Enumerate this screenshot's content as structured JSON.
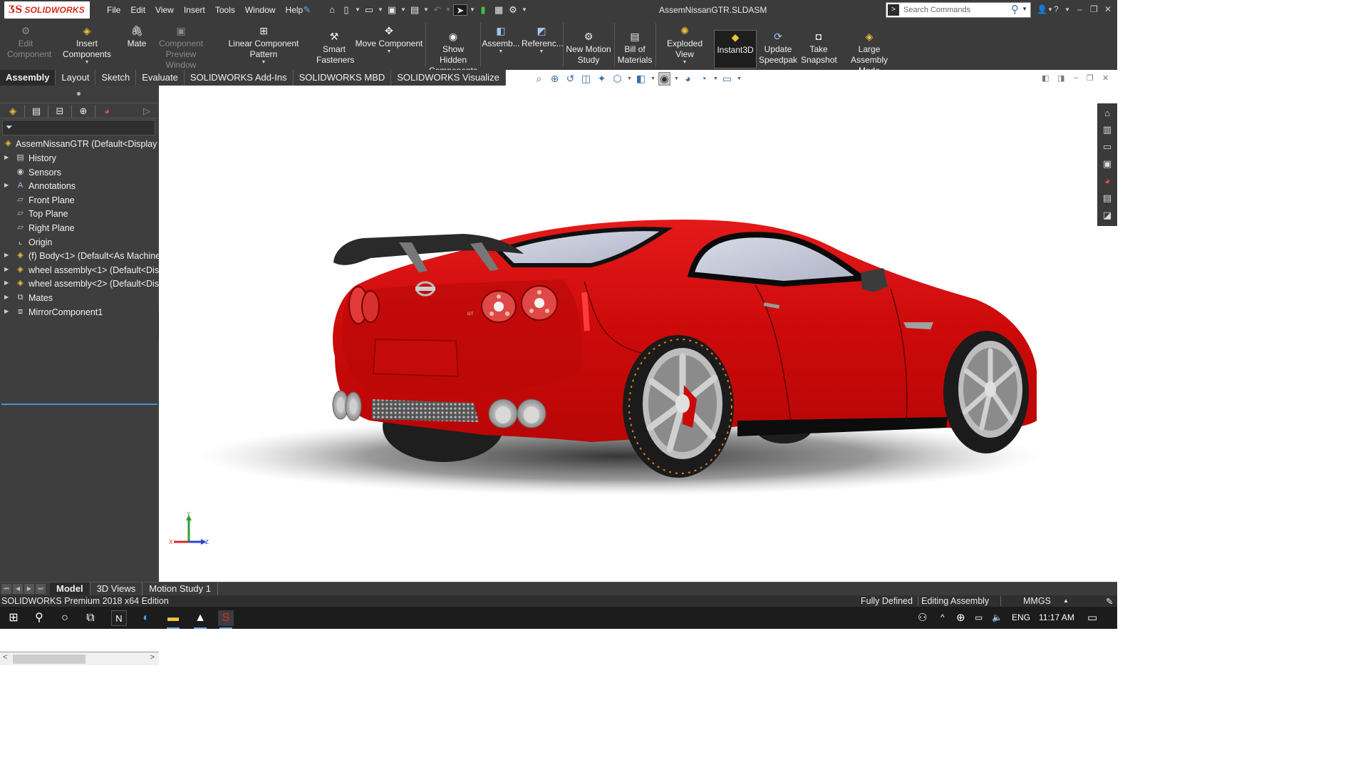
{
  "app": {
    "brand": "SOLIDWORKS",
    "document_title": "AssemNissanGTR.SLDASM",
    "accent_color": "#d52b1e"
  },
  "menu": [
    "File",
    "Edit",
    "View",
    "Insert",
    "Tools",
    "Window",
    "Help"
  ],
  "search": {
    "placeholder": "Search Commands"
  },
  "commands": {
    "edit_component": "Edit Component",
    "insert_components": "Insert Components",
    "mate": "Mate",
    "component_preview": "Component Preview Window",
    "linear_pattern": "Linear Component Pattern",
    "smart_fasteners": "Smart Fasteners",
    "move_component": "Move Component",
    "show_hidden": "Show Hidden Components",
    "assembly_features": "Assemb...",
    "reference_geometry": "Referenc...",
    "new_motion_study": "New Motion Study",
    "bill_of_materials": "Bill of Materials",
    "exploded_view": "Exploded View",
    "instant3d": "Instant3D",
    "update_speedpak": "Update Speedpak",
    "take_snapshot": "Take Snapshot",
    "large_assembly_mode": "Large Assembly Mode"
  },
  "tabs": [
    "Assembly",
    "Layout",
    "Sketch",
    "Evaluate",
    "SOLIDWORKS Add-Ins",
    "SOLIDWORKS MBD",
    "SOLIDWORKS Visualize"
  ],
  "tree": {
    "root": "AssemNissanGTR  (Default<Display S",
    "items": [
      {
        "label": "History",
        "icon": "history-icon",
        "expandable": true
      },
      {
        "label": "Sensors",
        "icon": "sensors-icon",
        "expandable": false
      },
      {
        "label": "Annotations",
        "icon": "annotations-icon",
        "expandable": true
      },
      {
        "label": "Front Plane",
        "icon": "plane-icon",
        "expandable": false
      },
      {
        "label": "Top Plane",
        "icon": "plane-icon",
        "expandable": false
      },
      {
        "label": "Right Plane",
        "icon": "plane-icon",
        "expandable": false
      },
      {
        "label": "Origin",
        "icon": "origin-icon",
        "expandable": false
      },
      {
        "label": "(f) Body<1> (Default<As Machine",
        "icon": "part-icon",
        "expandable": true
      },
      {
        "label": "wheel assembly<1> (Default<Dis",
        "icon": "subassembly-icon",
        "expandable": true
      },
      {
        "label": "wheel assembly<2> (Default<Dis",
        "icon": "subassembly-icon",
        "expandable": true
      },
      {
        "label": "Mates",
        "icon": "mates-icon",
        "expandable": true
      },
      {
        "label": "MirrorComponent1",
        "icon": "mirror-component-icon",
        "expandable": true
      }
    ]
  },
  "bottom_tabs": [
    "Model",
    "3D Views",
    "Motion Study 1"
  ],
  "status": {
    "edition": "SOLIDWORKS Premium 2018 x64 Edition",
    "defined": "Fully Defined",
    "mode": "Editing Assembly",
    "units": "MMGS"
  },
  "triad": {
    "y": "Y",
    "x": "X",
    "z": "Z"
  },
  "car_colors": {
    "body": "#d40b0b",
    "shadow": "#2e2e2e",
    "wheel": "#a9a9a9"
  },
  "taskbar": {
    "lang": "ENG",
    "time": "11:17 AM"
  }
}
